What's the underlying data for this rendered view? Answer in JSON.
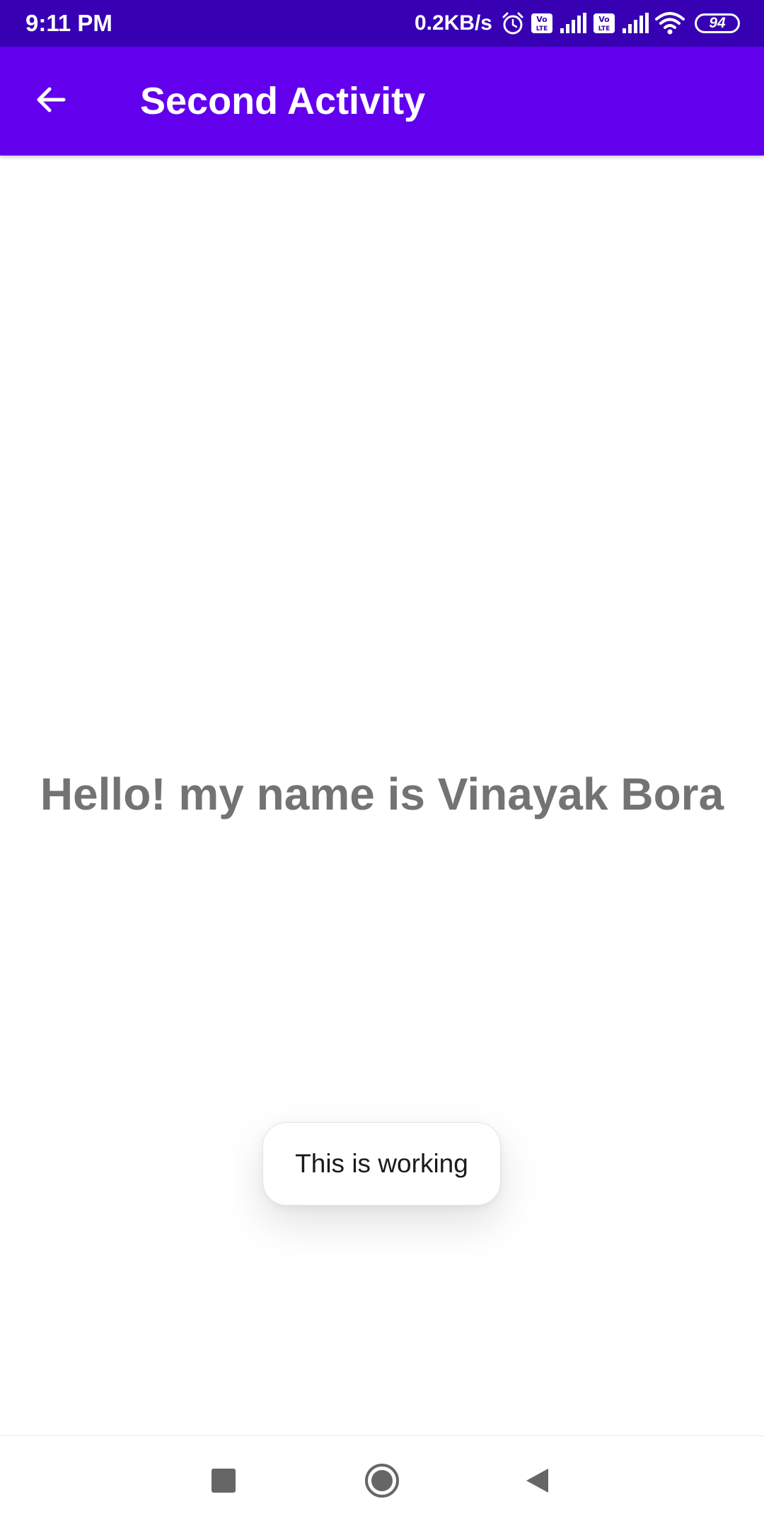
{
  "status_bar": {
    "time": "9:11 PM",
    "net_speed": "0.2KB/s",
    "icons": [
      "alarm-icon",
      "volte-icon",
      "signal-icon",
      "volte-icon",
      "signal-icon",
      "wifi-icon",
      "battery-icon"
    ],
    "battery_level": "94",
    "background": "#3700b3"
  },
  "app_bar": {
    "title": "Second Activity",
    "back_icon": "arrow-left-icon",
    "background": "#6200ee"
  },
  "content": {
    "greeting": "Hello! my name is Vinayak Bora",
    "text_color": "#737373"
  },
  "toast": {
    "message": "This is working"
  },
  "nav_bar": {
    "icons": [
      "recents-icon",
      "home-icon",
      "back-icon"
    ]
  }
}
